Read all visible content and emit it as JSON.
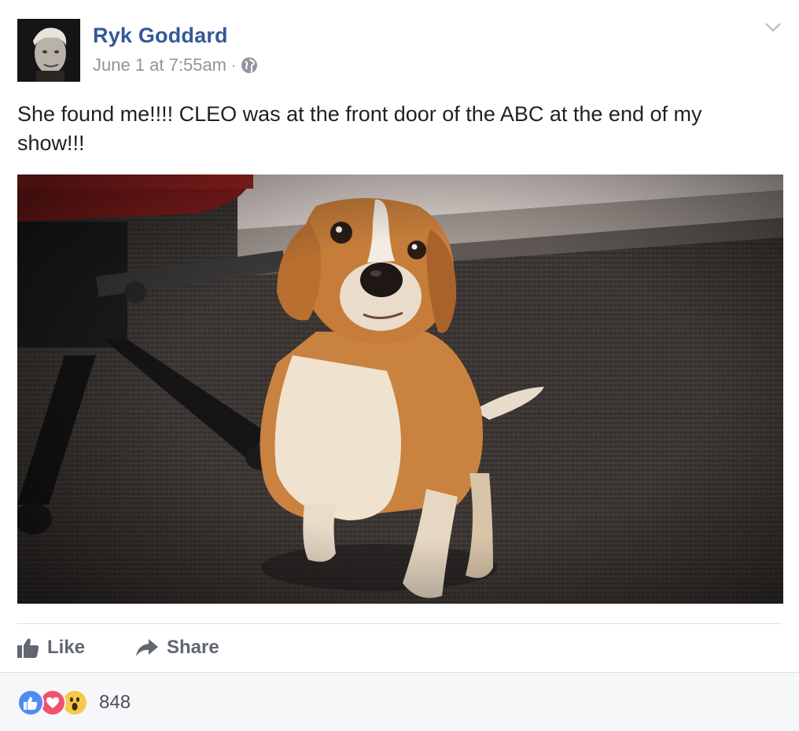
{
  "post": {
    "author": "Ryk Goddard",
    "timestamp": "June 1 at 7:55am",
    "separator": "·",
    "privacy_icon": "globe-icon",
    "menu_icon": "chevron-down-icon",
    "text": "She found me!!!! CLEO was at the front door of the ABC at the end of my show!!!",
    "photo_subject": "beagle dog sitting on carpet"
  },
  "actions": {
    "like_label": "Like",
    "share_label": "Share"
  },
  "reactions": {
    "types": [
      "like",
      "love",
      "wow"
    ],
    "count": "848"
  },
  "colors": {
    "author_link": "#365899",
    "meta_text": "#90949c",
    "action_text": "#616770",
    "like_reaction": "#4d8df3",
    "love_reaction": "#f0536c",
    "wow_reaction": "#f7c948"
  }
}
